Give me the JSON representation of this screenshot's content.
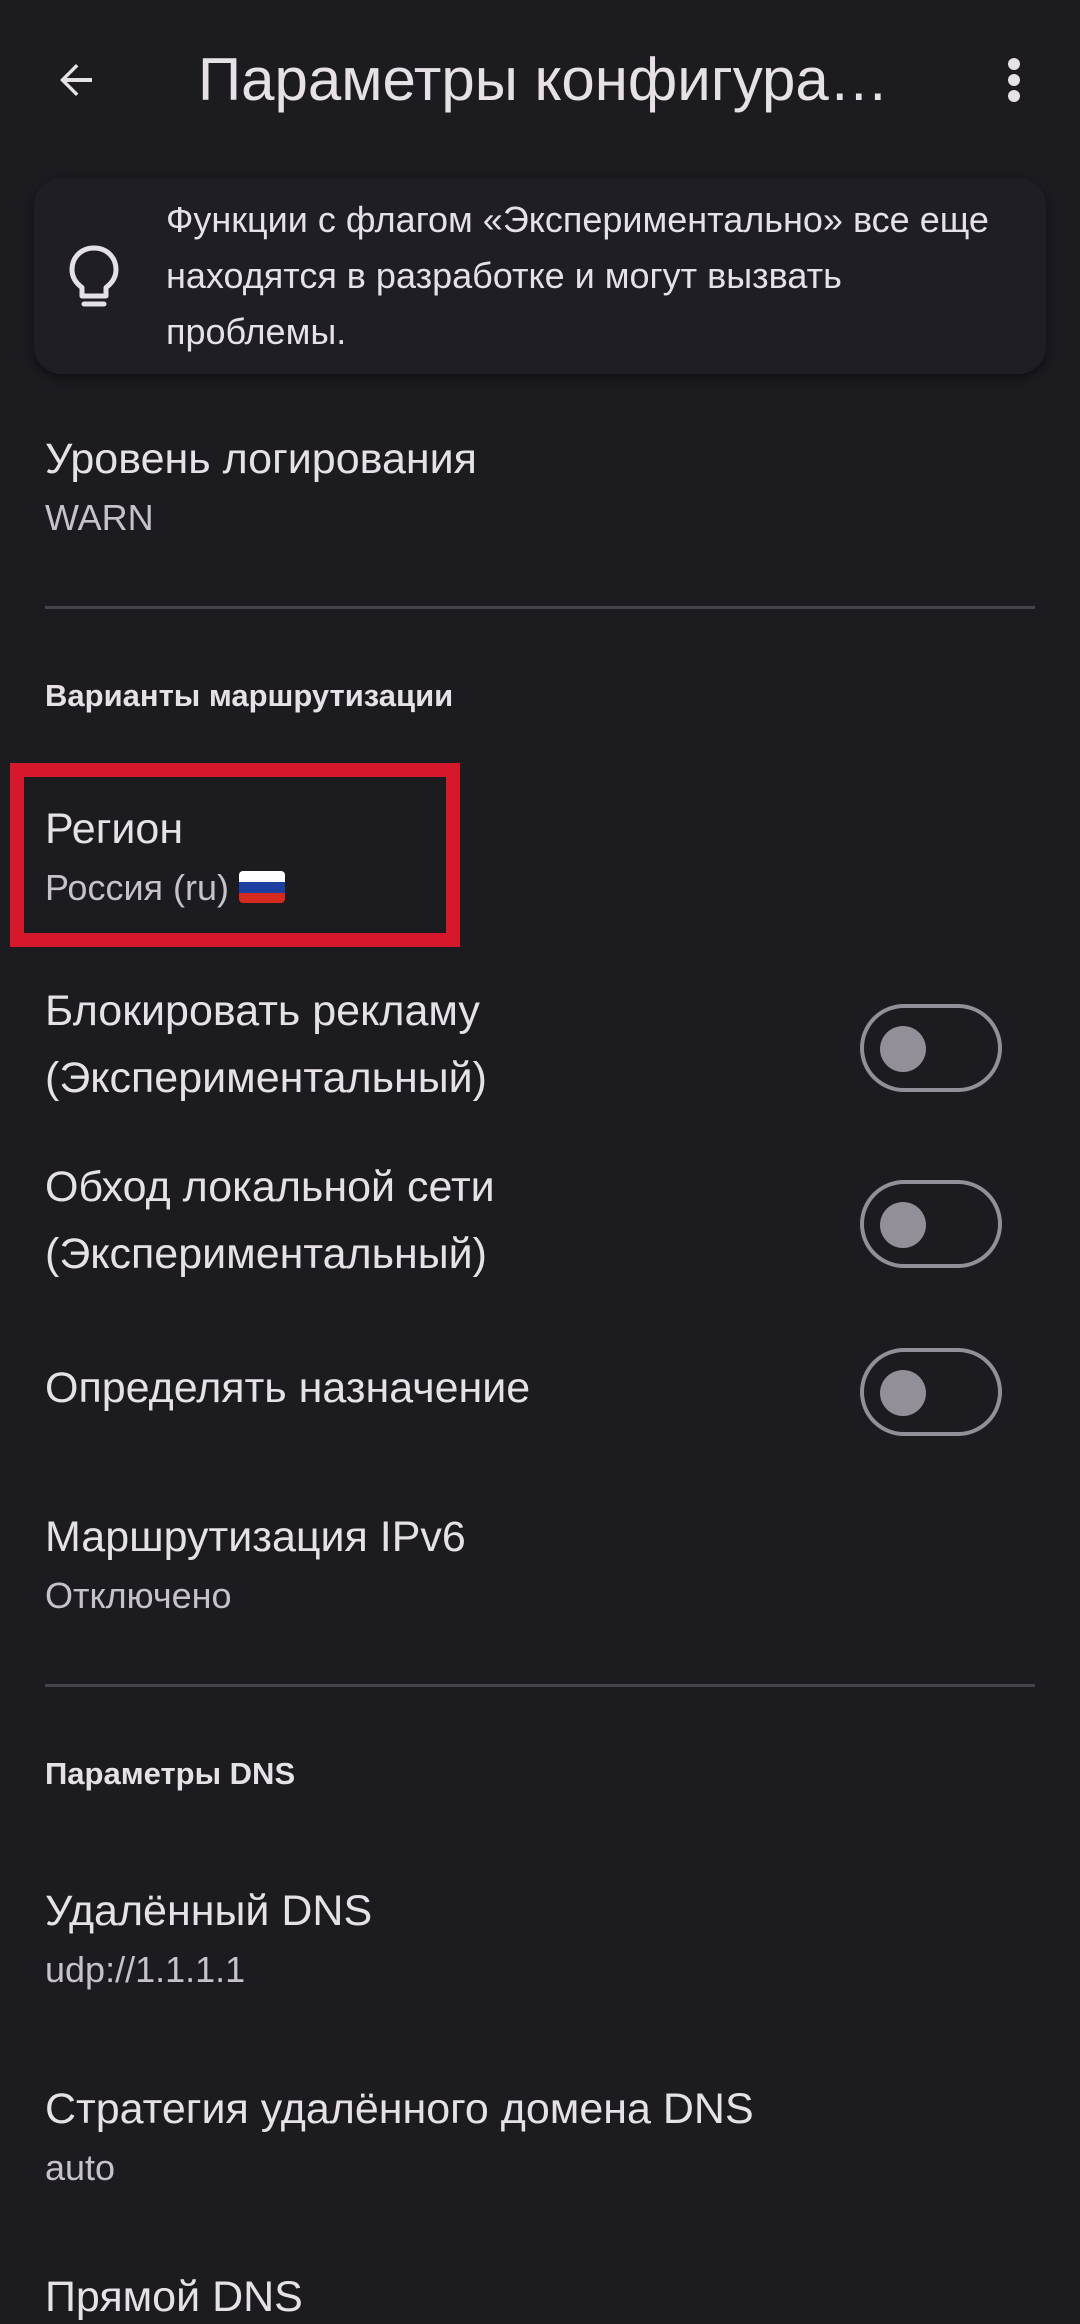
{
  "header": {
    "title": "Параметры конфигура…",
    "back_icon": "arrow-back-icon",
    "menu_icon": "more-vert-icon"
  },
  "info_card": {
    "icon": "lightbulb-icon",
    "text": "Функции с флагом «Экспериментально» все еще находятся в разработке и могут вызвать проблемы."
  },
  "log_level": {
    "title": "Уровень логирования",
    "value": "WARN"
  },
  "routing": {
    "header": "Варианты маршрутизации",
    "region": {
      "title": "Регион",
      "value": "Россия (ru)",
      "flag_colors": [
        "#ffffff",
        "#1c3fa0",
        "#d52b1e"
      ]
    },
    "block_ads": {
      "title_line1": "Блокировать рекламу",
      "title_line2": "(Экспериментальный)",
      "enabled": false
    },
    "bypass_lan": {
      "title_line1": "Обход локальной сети",
      "title_line2": "(Экспериментальный)",
      "enabled": false
    },
    "sniff": {
      "title": "Определять назначение",
      "enabled": false
    },
    "ipv6": {
      "title": "Маршрутизация IPv6",
      "value": "Отключено"
    }
  },
  "dns": {
    "header": "Параметры DNS",
    "remote": {
      "title": "Удалённый DNS",
      "value": "udp://1.1.1.1"
    },
    "remote_strategy": {
      "title": "Стратегия удалённого домена DNS",
      "value": "auto"
    },
    "direct": {
      "title": "Прямой DNS"
    }
  },
  "colors": {
    "background": "#1c1b20",
    "highlight": "#d5182b",
    "switch_outline": "#928f98"
  }
}
